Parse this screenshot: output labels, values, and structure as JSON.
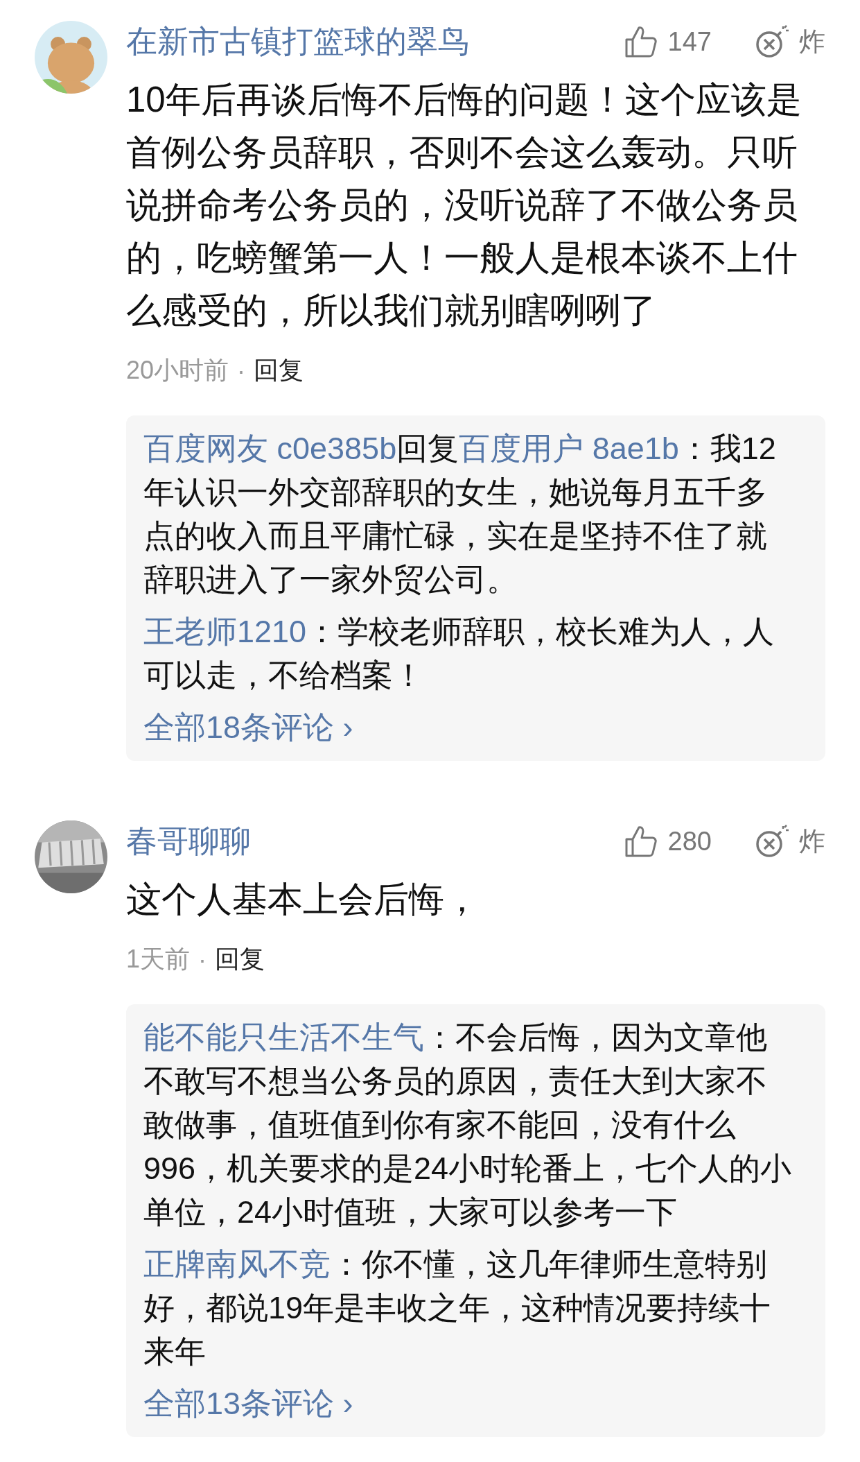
{
  "comments": [
    {
      "avatar": {
        "kind": "cartoon"
      },
      "name": "在新市古镇打篮球的翠鸟",
      "likes": "147",
      "bomb_label": "炸",
      "text": "10年后再谈后悔不后悔的问题！这个应该是首例公务员辞职，否则不会这么轰动。只听说拼命考公务员的，没听说辞了不做公务员的，吃螃蟹第一人！一般人是根本谈不上什么感受的，所以我们就别瞎咧咧了",
      "time": "20小时前",
      "dot": "·",
      "reply_label": "回复",
      "replies": [
        {
          "author": "百度网友 c0e385b",
          "verb": "回复",
          "reply_to": "百度用户 8ae1b",
          "text": "：我12年认识一外交部辞职的女生，她说每月五千多点的收入而且平庸忙碌，实在是坚持不住了就辞职进入了一家外贸公司。"
        },
        {
          "author": "王老师1210",
          "text": "：学校老师辞职，校长难为人，人可以走，不给档案！"
        }
      ],
      "all_link": "全部18条评论",
      "chevron": "›"
    },
    {
      "name": "春哥聊聊",
      "likes": "280",
      "bomb_label": "炸",
      "text": "这个人基本上会后悔，",
      "time": "1天前",
      "dot": "·",
      "reply_label": "回复",
      "replies": [
        {
          "author": "能不能只生活不生气",
          "text": "：不会后悔，因为文章他不敢写不想当公务员的原因，责任大到大家不敢做事，值班值到你有家不能回，没有什么996，机关要求的是24小时轮番上，七个人的小单位，24小时值班，大家可以参考一下"
        },
        {
          "author": "正牌南风不竞",
          "text": "：你不懂，这几年律师生意特别好，都说19年是丰收之年，这种情况要持续十来年"
        }
      ],
      "all_link": "全部13条评论",
      "chevron": "›"
    }
  ]
}
